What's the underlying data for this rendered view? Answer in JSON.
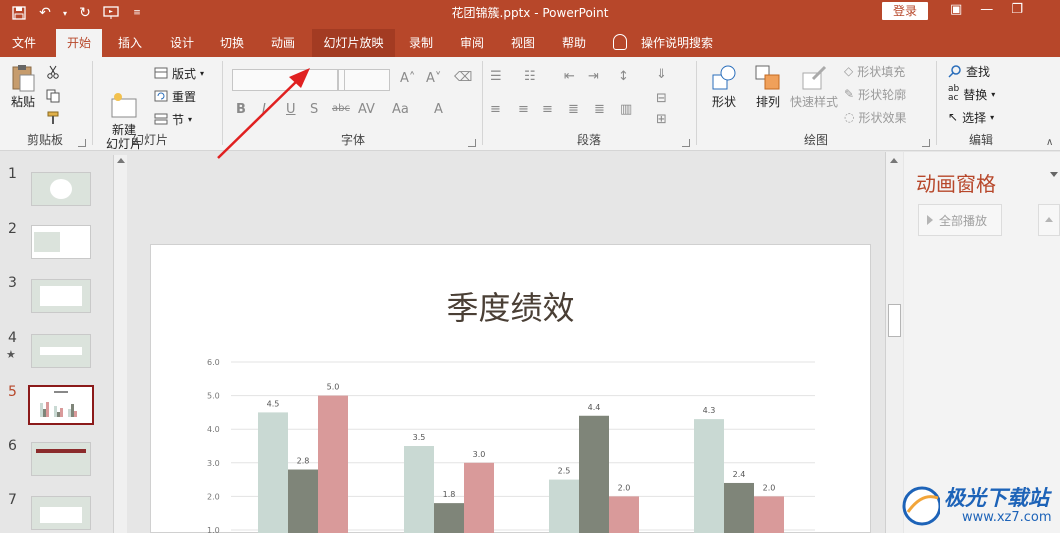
{
  "titlebar": {
    "doc_title": "花团锦簇.pptx  -  PowerPoint",
    "login_label": "登录"
  },
  "tabs": [
    {
      "label": "文件"
    },
    {
      "label": "开始"
    },
    {
      "label": "插入"
    },
    {
      "label": "设计"
    },
    {
      "label": "切换"
    },
    {
      "label": "动画"
    },
    {
      "label": "幻灯片放映"
    },
    {
      "label": "录制"
    },
    {
      "label": "审阅"
    },
    {
      "label": "视图"
    },
    {
      "label": "帮助"
    },
    {
      "label": "操作说明搜索"
    }
  ],
  "ribbon": {
    "clipboard": {
      "group_label": "剪贴板",
      "paste_label": "粘贴"
    },
    "slides": {
      "group_label": "幻灯片",
      "new_slide_label": "新建\n幻灯片",
      "layout_label": "版式",
      "reset_label": "重置",
      "section_label": "节"
    },
    "font": {
      "group_label": "字体"
    },
    "paragraph": {
      "group_label": "段落"
    },
    "drawing": {
      "group_label": "绘图",
      "shape_label": "形状",
      "arrange_label": "排列",
      "quick_styles_label": "快速样式",
      "shape_fill_label": "形状填充",
      "shape_outline_label": "形状轮廓",
      "shape_effects_label": "形状效果"
    },
    "editing": {
      "group_label": "编辑",
      "find_label": "查找",
      "replace_label": "替换",
      "select_label": "选择"
    }
  },
  "thumbnails": [
    {
      "num": "1"
    },
    {
      "num": "2"
    },
    {
      "num": "3"
    },
    {
      "num": "4",
      "star": "★"
    },
    {
      "num": "5",
      "current": true
    },
    {
      "num": "6"
    },
    {
      "num": "7"
    }
  ],
  "anim_pane": {
    "title": "动画窗格",
    "play_all_label": "全部播放"
  },
  "watermark": {
    "text": "极光下载站",
    "url": "www.xz7.com"
  },
  "colors": {
    "accent": "#b7472a",
    "series_a": "#c9d9d3",
    "series_b": "#7f8579",
    "series_c": "#d99a9a"
  },
  "chart_data": {
    "type": "bar",
    "title": "季度绩效",
    "categories": [
      "",
      "",
      "",
      ""
    ],
    "series": [
      {
        "values": [
          4.5,
          3.5,
          2.5,
          4.3
        ]
      },
      {
        "values": [
          2.8,
          1.8,
          4.4,
          2.4
        ]
      },
      {
        "values": [
          5.0,
          3.0,
          2.0,
          2.0
        ]
      }
    ],
    "ylim": [
      0,
      6
    ],
    "yticks": [
      "6.0",
      "5.0",
      "4.0",
      "3.0",
      "2.0",
      "1.0"
    ],
    "grid": true
  }
}
